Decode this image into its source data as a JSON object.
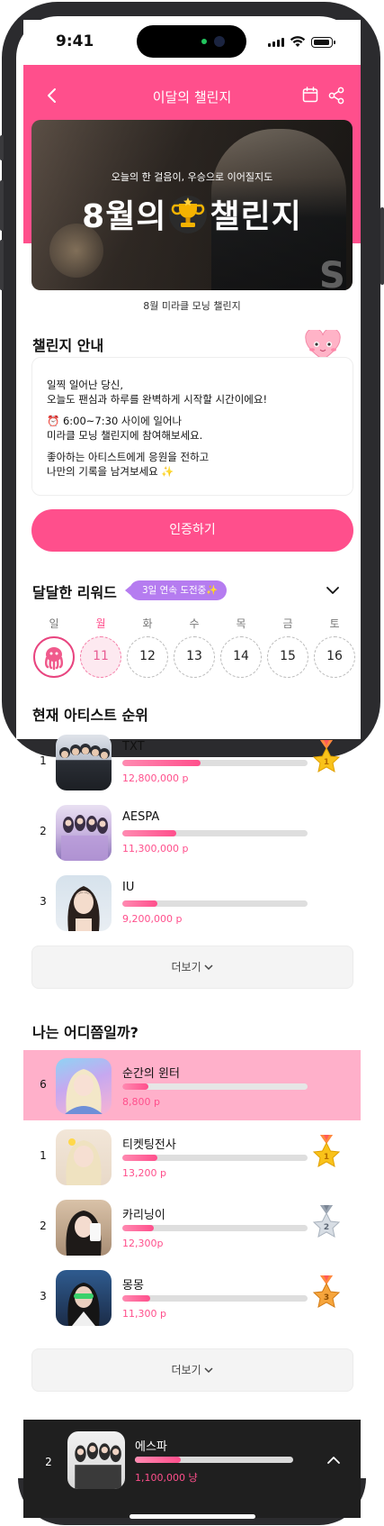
{
  "status_bar": {
    "time": "9:41"
  },
  "header": {
    "title": "이달의 챌린지"
  },
  "banner": {
    "tagline": "오늘의 한 걸음이, 우승으로 이어질지도",
    "title_left": "8월의",
    "title_right": "챌린지",
    "caption": "8월 미라클 모닝 챌린지"
  },
  "guide": {
    "title": "챌린지 안내",
    "lines": [
      "일찍 일어난 당신,",
      "오늘도 팬심과 하루를 완벽하게 시작할 시간이에요!",
      "6:00~7:30 사이에 일어나",
      "미라클 모닝 챌린지에 참여해보세요.",
      "좋아하는 아티스트에게 응원을 전하고",
      "나만의 기록을 남겨보세요 ✨"
    ],
    "cta": "인증하기"
  },
  "rewards": {
    "title": "달달한 리워드",
    "streak": "3일 연속 도전중✨",
    "weekdays": [
      "일",
      "월",
      "화",
      "수",
      "목",
      "금",
      "토"
    ],
    "days": [
      "",
      "11",
      "12",
      "13",
      "14",
      "15",
      "16"
    ],
    "colors": {
      "accent": "#ff4f8c",
      "streak": "#b57cf0"
    }
  },
  "artist_ranking": {
    "title": "현재 아티스트 순위",
    "rows": [
      {
        "rank": "1",
        "name": "TXT",
        "points": "12,800,000 p",
        "progress": 0.42,
        "medal": "gold-medal-1"
      },
      {
        "rank": "2",
        "name": "AESPA",
        "points": "11,300,000 p",
        "progress": 0.29
      },
      {
        "rank": "3",
        "name": "IU",
        "points": "9,200,000 p",
        "progress": 0.19
      }
    ],
    "more": "더보기"
  },
  "my_ranking": {
    "title": "나는 어디쯤일까?",
    "me": {
      "rank": "6",
      "name": "순간의 윈터",
      "points": "8,800 p",
      "progress": 0.14
    },
    "rows": [
      {
        "rank": "1",
        "name": "티켓팅전사",
        "points": "13,200 p",
        "progress": 0.19,
        "medal": "gold-medal-1"
      },
      {
        "rank": "2",
        "name": "카리닝이",
        "points": "12,300p",
        "progress": 0.17,
        "medal": "silver-medal-2"
      },
      {
        "rank": "3",
        "name": "몽몽",
        "points": "11,300 p",
        "progress": 0.15,
        "medal": "bronze-medal-3"
      }
    ],
    "more": "더보기"
  },
  "sticky": {
    "rank": "2",
    "name": "에스파",
    "points": "1,100,000 냥",
    "progress": 0.29
  }
}
